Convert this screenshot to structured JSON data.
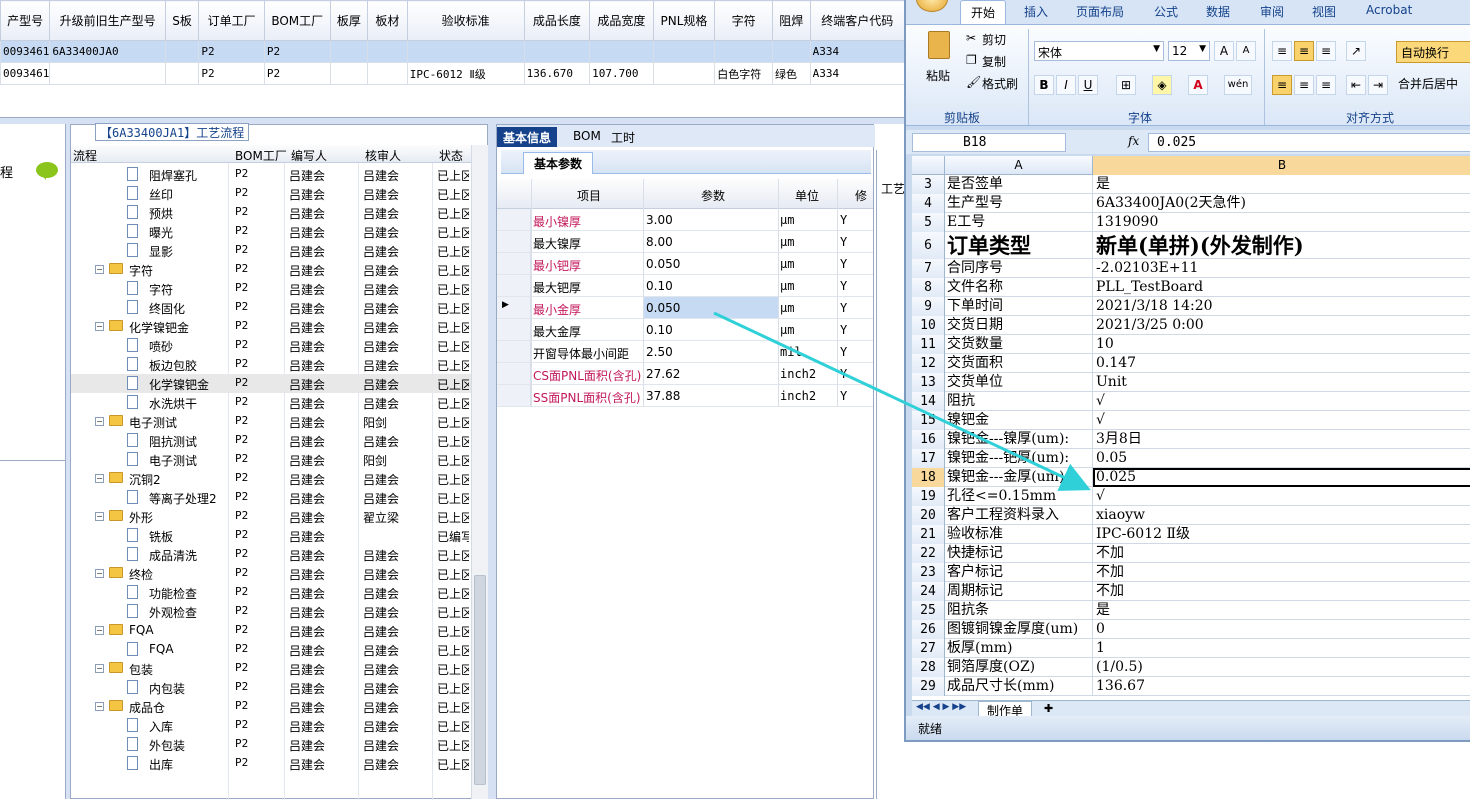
{
  "top_grid": {
    "headers": [
      "产型号",
      "升级前旧生产型号",
      "S板",
      "订单工厂",
      "BOM工厂",
      "板厚",
      "板材",
      "验收标准",
      "成品长度",
      "成品宽度",
      "PNL规格",
      "字符",
      "阻焊",
      "终端客户代码"
    ],
    "rows": [
      [
        "0093461",
        "6A33400JA0",
        "",
        "P2",
        "P2",
        "",
        "",
        "",
        "",
        "",
        "",
        "",
        "",
        "A334"
      ],
      [
        "0093461",
        "",
        "",
        "P2",
        "P2",
        "",
        "",
        "IPC-6012 Ⅱ级",
        "136.670",
        "107.700",
        "",
        "白色字符",
        "绿色",
        "A334"
      ]
    ]
  },
  "left_strip": {
    "label": "程"
  },
  "process_panel": {
    "title": "【6A33400JA1】工艺流程",
    "headers": [
      "流程",
      "BOM工厂",
      "编写人",
      "核审人",
      "状态"
    ],
    "rows": [
      {
        "kind": "doc",
        "level": 2,
        "name": "阻焊塞孔",
        "bom": "P2",
        "writer": "吕建会",
        "reviewer": "吕建会",
        "status": "已上区"
      },
      {
        "kind": "doc",
        "level": 2,
        "name": "丝印",
        "bom": "P2",
        "writer": "吕建会",
        "reviewer": "吕建会",
        "status": "已上区"
      },
      {
        "kind": "doc",
        "level": 2,
        "name": "预烘",
        "bom": "P2",
        "writer": "吕建会",
        "reviewer": "吕建会",
        "status": "已上区"
      },
      {
        "kind": "doc",
        "level": 2,
        "name": "曝光",
        "bom": "P2",
        "writer": "吕建会",
        "reviewer": "吕建会",
        "status": "已上区"
      },
      {
        "kind": "doc",
        "level": 2,
        "name": "显影",
        "bom": "P2",
        "writer": "吕建会",
        "reviewer": "吕建会",
        "status": "已上区"
      },
      {
        "kind": "folder",
        "level": 1,
        "name": "字符",
        "bom": "P2",
        "writer": "吕建会",
        "reviewer": "吕建会",
        "status": "已上区"
      },
      {
        "kind": "doc",
        "level": 2,
        "name": "字符",
        "bom": "P2",
        "writer": "吕建会",
        "reviewer": "吕建会",
        "status": "已上区"
      },
      {
        "kind": "doc",
        "level": 2,
        "name": "终固化",
        "bom": "P2",
        "writer": "吕建会",
        "reviewer": "吕建会",
        "status": "已上区"
      },
      {
        "kind": "folder",
        "level": 1,
        "name": "化学镍钯金",
        "bom": "P2",
        "writer": "吕建会",
        "reviewer": "吕建会",
        "status": "已上区"
      },
      {
        "kind": "doc",
        "level": 2,
        "name": "喷砂",
        "bom": "P2",
        "writer": "吕建会",
        "reviewer": "吕建会",
        "status": "已上区"
      },
      {
        "kind": "doc",
        "level": 2,
        "name": "板边包胶",
        "bom": "P2",
        "writer": "吕建会",
        "reviewer": "吕建会",
        "status": "已上区"
      },
      {
        "kind": "doc",
        "level": 2,
        "name": "化学镍钯金",
        "bom": "P2",
        "writer": "吕建会",
        "reviewer": "吕建会",
        "status": "已上区",
        "selected": true
      },
      {
        "kind": "doc",
        "level": 2,
        "name": "水洗烘干",
        "bom": "P2",
        "writer": "吕建会",
        "reviewer": "吕建会",
        "status": "已上区"
      },
      {
        "kind": "folder",
        "level": 1,
        "name": "电子测试",
        "bom": "P2",
        "writer": "吕建会",
        "reviewer": "阳剑",
        "status": "已上区"
      },
      {
        "kind": "doc",
        "level": 2,
        "name": "阻抗测试",
        "bom": "P2",
        "writer": "吕建会",
        "reviewer": "吕建会",
        "status": "已上区"
      },
      {
        "kind": "doc",
        "level": 2,
        "name": "电子测试",
        "bom": "P2",
        "writer": "吕建会",
        "reviewer": "阳剑",
        "status": "已上区"
      },
      {
        "kind": "folder",
        "level": 1,
        "name": "沉铜2",
        "bom": "P2",
        "writer": "吕建会",
        "reviewer": "吕建会",
        "status": "已上区"
      },
      {
        "kind": "doc",
        "level": 2,
        "name": "等离子处理2",
        "bom": "P2",
        "writer": "吕建会",
        "reviewer": "吕建会",
        "status": "已上区"
      },
      {
        "kind": "folder",
        "level": 1,
        "name": "外形",
        "bom": "P2",
        "writer": "吕建会",
        "reviewer": "翟立梁",
        "status": "已上区"
      },
      {
        "kind": "doc",
        "level": 2,
        "name": "铣板",
        "bom": "P2",
        "writer": "吕建会",
        "reviewer": "",
        "status": "已编写"
      },
      {
        "kind": "doc",
        "level": 2,
        "name": "成品清洗",
        "bom": "P2",
        "writer": "吕建会",
        "reviewer": "吕建会",
        "status": "已上区"
      },
      {
        "kind": "folder",
        "level": 1,
        "name": "终检",
        "bom": "P2",
        "writer": "吕建会",
        "reviewer": "吕建会",
        "status": "已上区"
      },
      {
        "kind": "doc",
        "level": 2,
        "name": "功能检查",
        "bom": "P2",
        "writer": "吕建会",
        "reviewer": "吕建会",
        "status": "已上区"
      },
      {
        "kind": "doc",
        "level": 2,
        "name": "外观检查",
        "bom": "P2",
        "writer": "吕建会",
        "reviewer": "吕建会",
        "status": "已上区"
      },
      {
        "kind": "folder",
        "level": 1,
        "name": "FQA",
        "bom": "P2",
        "writer": "吕建会",
        "reviewer": "吕建会",
        "status": "已上区"
      },
      {
        "kind": "doc",
        "level": 2,
        "name": "FQA",
        "bom": "P2",
        "writer": "吕建会",
        "reviewer": "吕建会",
        "status": "已上区"
      },
      {
        "kind": "folder",
        "level": 1,
        "name": "包装",
        "bom": "P2",
        "writer": "吕建会",
        "reviewer": "吕建会",
        "status": "已上区"
      },
      {
        "kind": "doc",
        "level": 2,
        "name": "内包装",
        "bom": "P2",
        "writer": "吕建会",
        "reviewer": "吕建会",
        "status": "已上区"
      },
      {
        "kind": "folder",
        "level": 1,
        "name": "成品仓",
        "bom": "P2",
        "writer": "吕建会",
        "reviewer": "吕建会",
        "status": "已上区"
      },
      {
        "kind": "doc",
        "level": 2,
        "name": "入库",
        "bom": "P2",
        "writer": "吕建会",
        "reviewer": "吕建会",
        "status": "已上区"
      },
      {
        "kind": "doc",
        "level": 2,
        "name": "外包装",
        "bom": "P2",
        "writer": "吕建会",
        "reviewer": "吕建会",
        "status": "已上区"
      },
      {
        "kind": "doc",
        "level": 2,
        "name": "出库",
        "bom": "P2",
        "writer": "吕建会",
        "reviewer": "吕建会",
        "status": "已上区"
      }
    ]
  },
  "param_panel": {
    "tabs": [
      "基本信息",
      "BOM",
      "工时"
    ],
    "subtab": "基本参数",
    "headers": [
      "项目",
      "参数",
      "单位",
      "修"
    ],
    "rows": [
      {
        "item": "最小镍厚",
        "value": "3.00",
        "unit": "μm",
        "flag": "Y",
        "pink": true
      },
      {
        "item": "最大镍厚",
        "value": "8.00",
        "unit": "μm",
        "flag": "Y",
        "pink": false
      },
      {
        "item": "最小钯厚",
        "value": "0.050",
        "unit": "μm",
        "flag": "Y",
        "pink": true
      },
      {
        "item": "最大钯厚",
        "value": "0.10",
        "unit": "μm",
        "flag": "Y",
        "pink": false
      },
      {
        "item": "最小金厚",
        "value": "0.050",
        "unit": "μm",
        "flag": "Y",
        "pink": true,
        "selected": true
      },
      {
        "item": "最大金厚",
        "value": "0.10",
        "unit": "μm",
        "flag": "Y",
        "pink": false
      },
      {
        "item": "开窗导体最小间距",
        "value": "2.50",
        "unit": "mil",
        "flag": "Y",
        "pink": false
      },
      {
        "item": "CS面PNL面积(含孔)",
        "value": "27.62",
        "unit": "inch2",
        "flag": "Y",
        "pink": true
      },
      {
        "item": "SS面PNL面积(含孔)",
        "value": "37.88",
        "unit": "inch2",
        "flag": "Y",
        "pink": true
      }
    ]
  },
  "mini_strip": {
    "label": "工艺"
  },
  "excel": {
    "tabs": [
      "开始",
      "插入",
      "页面布局",
      "公式",
      "数据",
      "审阅",
      "视图",
      "Acrobat"
    ],
    "clipboard": {
      "paste": "粘贴",
      "cut": "剪切",
      "copy": "复制",
      "format_painter": "格式刷",
      "group": "剪贴板"
    },
    "font": {
      "name": "宋体",
      "size": "12",
      "group": "字体"
    },
    "align": {
      "wrap": "自动换行",
      "merge": "合并后居中",
      "group": "对齐方式"
    },
    "name_box": "B18",
    "fx_label": "fx",
    "formula_value": "0.025",
    "col_a": "A",
    "col_b": "B",
    "rows": [
      {
        "n": "3",
        "a": "是否签单",
        "b": "是"
      },
      {
        "n": "4",
        "a": "生产型号",
        "b": "6A33400JA0(2天急件)"
      },
      {
        "n": "5",
        "a": "E工号",
        "b": "1319090"
      },
      {
        "n": "6",
        "a": "订单类型",
        "b": "新单(单拼)(外发制作)",
        "big": true
      },
      {
        "n": "7",
        "a": "合同序号",
        "b": "-2.02103E+11"
      },
      {
        "n": "8",
        "a": "文件名称",
        "b": "PLL_TestBoard"
      },
      {
        "n": "9",
        "a": "下单时间",
        "b": "2021/3/18 14:20"
      },
      {
        "n": "10",
        "a": "交货日期",
        "b": "2021/3/25 0:00"
      },
      {
        "n": "11",
        "a": "交货数量",
        "b": "10"
      },
      {
        "n": "12",
        "a": "交货面积",
        "b": "0.147"
      },
      {
        "n": "13",
        "a": "交货单位",
        "b": "Unit"
      },
      {
        "n": "14",
        "a": "阻抗",
        "b": "√"
      },
      {
        "n": "15",
        "a": "镍钯金",
        "b": "√"
      },
      {
        "n": "16",
        "a": "镍钯金---镍厚(um):",
        "b": "3月8日"
      },
      {
        "n": "17",
        "a": "镍钯金---钯厚(um):",
        "b": "0.05"
      },
      {
        "n": "18",
        "a": "镍钯金---金厚(um):",
        "b": "0.025",
        "selected": true
      },
      {
        "n": "19",
        "a": "孔径<=0.15mm",
        "b": "√"
      },
      {
        "n": "20",
        "a": "客户工程资料录入",
        "b": "xiaoyw"
      },
      {
        "n": "21",
        "a": "验收标准",
        "b": "IPC-6012 Ⅱ级"
      },
      {
        "n": "22",
        "a": "快捷标记",
        "b": "不加"
      },
      {
        "n": "23",
        "a": "客户标记",
        "b": "不加"
      },
      {
        "n": "24",
        "a": "周期标记",
        "b": "不加"
      },
      {
        "n": "25",
        "a": "阻抗条",
        "b": "是"
      },
      {
        "n": "26",
        "a": "图镀铜镍金厚度(um)",
        "b": "0"
      },
      {
        "n": "27",
        "a": "板厚(mm)",
        "b": "1"
      },
      {
        "n": "28",
        "a": "铜箔厚度(OZ)",
        "b": "(1/0.5)"
      },
      {
        "n": "29",
        "a": "成品尺寸长(mm)",
        "b": "136.67"
      }
    ],
    "sheet_tab": "制作单",
    "status": "就绪"
  },
  "colors": {
    "arrow": "#2fd0d8",
    "selection": "#c7daf4",
    "pink_text": "#c2185b",
    "tab_active": "#15428b"
  }
}
